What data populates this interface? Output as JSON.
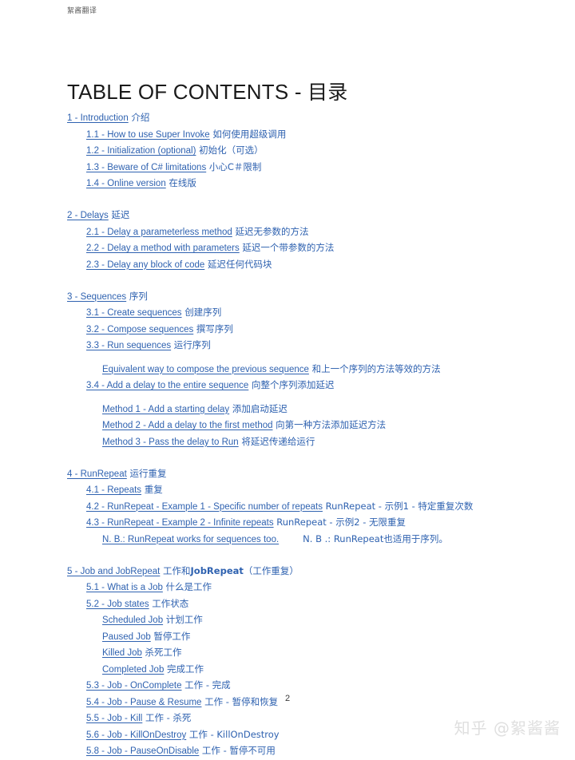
{
  "header": {
    "label": "絮酱翻译"
  },
  "title": {
    "english": "TABLE OF CONTENTS - ",
    "chinese": "目录"
  },
  "toc": {
    "sections": [
      {
        "level": 1,
        "en": "1 - Introduction",
        "zh": " 介绍"
      },
      {
        "level": 2,
        "en": "1.1 - How to use Super Invoke",
        "zh": " 如何使用超级调用"
      },
      {
        "level": 2,
        "en": "1.2 - Initialization (optional)",
        "zh": " 初始化（可选）"
      },
      {
        "level": 2,
        "en": "1.3 - Beware of C# limitations",
        "zh": " 小心C＃限制"
      },
      {
        "level": 2,
        "en": "1.4 - Online version",
        "zh": " 在线版"
      },
      {
        "level": 1,
        "en": "2 - Delays",
        "zh": " 延迟"
      },
      {
        "level": 2,
        "en": "2.1 - Delay a parameterless method",
        "zh": " 延迟无参数的方法"
      },
      {
        "level": 2,
        "en": "2.2 - Delay a method with parameters",
        "zh": " 延迟一个带参数的方法"
      },
      {
        "level": 2,
        "en": "2.3 - Delay any block of code",
        "zh": " 延迟任何代码块"
      },
      {
        "level": 1,
        "en": "3 - Sequences",
        "zh": " 序列"
      },
      {
        "level": 2,
        "en": "3.1 - Create sequences",
        "zh": " 创建序列"
      },
      {
        "level": 2,
        "en": "3.2 - Compose sequences",
        "zh": " 撰写序列"
      },
      {
        "level": 2,
        "en": "3.3 - Run sequences",
        "zh": " 运行序列"
      },
      {
        "level": 3,
        "en": "Equivalent way to compose the previous sequence",
        "zh": " 和上一个序列的方法等效的方法"
      },
      {
        "level": 2,
        "en": "3.4 - Add a delay to the entire sequence",
        "zh": " 向整个序列添加延迟"
      },
      {
        "level": 3,
        "en": "Method 1 - Add a starting delay",
        "zh": " 添加启动延迟"
      },
      {
        "level": 3,
        "en": "Method 2 - Add a delay to the first method",
        "zh": " 向第一种方法添加延迟方法"
      },
      {
        "level": 3,
        "en": "Method 3 - Pass the delay to Run",
        "zh": " 将延迟传递给运行"
      },
      {
        "level": 1,
        "en": "4 - RunRepeat",
        "zh": " 运行重复"
      },
      {
        "level": 2,
        "en": "4.1 - Repeats",
        "zh": " 重复"
      },
      {
        "level": 2,
        "en": "4.2 - RunRepeat - Example 1 - Specific number of repeats",
        "zh": " RunRepeat - 示例1 - 特定重复次数"
      },
      {
        "level": 2,
        "en": "4.3 - RunRepeat - Example 2 - Infinite repeats",
        "zh": " RunRepeat - 示例2 - 无限重复"
      },
      {
        "level": 3,
        "en": "N. B.: RunRepeat works for sequences too.",
        "zh": "N. B .: RunRepeat也适用于序列。"
      },
      {
        "level": 1,
        "en": "5 - Job and JobRepeat",
        "zh": " 工作和JobRepeat（工作重复）"
      },
      {
        "level": 2,
        "en": "5.1 - What is a Job",
        "zh": " 什么是工作"
      },
      {
        "level": 2,
        "en": "5.2 - Job states",
        "zh": " 工作状态"
      },
      {
        "level": 3,
        "en": "Scheduled Job",
        "zh": " 计划工作"
      },
      {
        "level": 3,
        "en": "Paused Job",
        "zh": " 暂停工作"
      },
      {
        "level": 3,
        "en": "Killed Job",
        "zh": " 杀死工作"
      },
      {
        "level": 3,
        "en": "Completed Job",
        "zh": " 完成工作"
      },
      {
        "level": 2,
        "en": "5.3 - Job - OnComplete",
        "zh": " 工作 - 完成"
      },
      {
        "level": 2,
        "en": "5.4 - Job - Pause & Resume",
        "zh": " 工作 - 暂停和恢复"
      },
      {
        "level": 2,
        "en": "5.5 - Job - Kill",
        "zh": " 工作 - 杀死"
      },
      {
        "level": 2,
        "en": "5.6 - Job - KillOnDestroy",
        "zh": " 工作 - KillOnDestroy"
      },
      {
        "level": 2,
        "en": "5.8 - Job - PauseOnDisable",
        "zh": " 工作 - 暂停不可用"
      }
    ]
  },
  "footer": {
    "page_number": "2",
    "watermark": "知乎 @絮酱酱"
  },
  "colors": {
    "link": "#2f62b0",
    "title": "#1a1a1a",
    "watermark": "#dfdfdf"
  }
}
